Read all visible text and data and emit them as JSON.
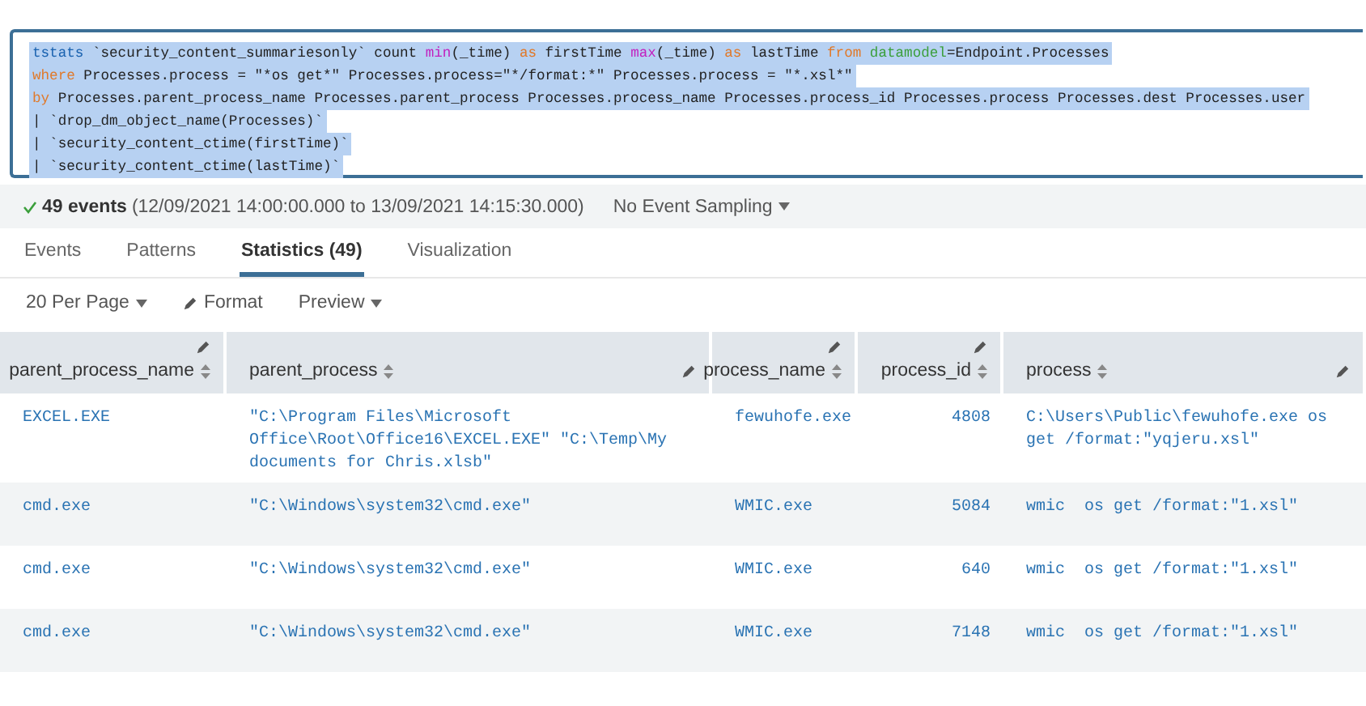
{
  "query": {
    "lines": [
      [
        {
          "kind": "command",
          "text": "tstats"
        },
        {
          "kind": "text",
          "text": " `security_content_summariesonly` count "
        },
        {
          "kind": "function",
          "text": "min"
        },
        {
          "kind": "text",
          "text": "(_time) "
        },
        {
          "kind": "keyword",
          "text": "as"
        },
        {
          "kind": "text",
          "text": " firstTime "
        },
        {
          "kind": "function",
          "text": "max"
        },
        {
          "kind": "text",
          "text": "(_time) "
        },
        {
          "kind": "keyword",
          "text": "as"
        },
        {
          "kind": "text",
          "text": " lastTime "
        },
        {
          "kind": "keyword",
          "text": "from"
        },
        {
          "kind": "argument",
          "text": " datamodel"
        },
        {
          "kind": "text",
          "text": "=Endpoint.Processes"
        }
      ],
      [
        {
          "kind": "keyword",
          "text": "where"
        },
        {
          "kind": "text",
          "text": " Processes.process = \"*os get*\" Processes.process=\"*/format:*\" Processes.process = \"*.xsl*\""
        }
      ],
      [
        {
          "kind": "keyword",
          "text": "by"
        },
        {
          "kind": "text",
          "text": " Processes.parent_process_name Processes.parent_process Processes.process_name Processes.process_id Processes.process Processes.dest Processes.user"
        }
      ],
      [
        {
          "kind": "text",
          "text": "| `drop_dm_object_name(Processes)`"
        }
      ],
      [
        {
          "kind": "text",
          "text": "| `security_content_ctime(firstTime)`"
        }
      ],
      [
        {
          "kind": "text",
          "text": "| `security_content_ctime(lastTime)`"
        }
      ]
    ]
  },
  "summary": {
    "count": "49 events",
    "range": "(12/09/2021 14:00:00.000 to 13/09/2021 14:15:30.000)",
    "sampling": "No Event Sampling"
  },
  "tabs": [
    {
      "label": "Events",
      "selected": false
    },
    {
      "label": "Patterns",
      "selected": false
    },
    {
      "label": "Statistics (49)",
      "selected": true
    },
    {
      "label": "Visualization",
      "selected": false
    }
  ],
  "toolbar": {
    "per_page": "20 Per Page",
    "format": "Format",
    "preview": "Preview"
  },
  "table": {
    "columns": [
      "parent_process_name",
      "parent_process",
      "process_name",
      "process_id",
      "process"
    ],
    "rows": [
      [
        "EXCEL.EXE",
        "\"C:\\Program Files\\Microsoft Office\\Root\\Office16\\EXCEL.EXE\" \"C:\\Temp\\My documents for Chris.xlsb\"",
        "fewuhofe.exe",
        "4808",
        "C:\\Users\\Public\\fewuhofe.exe os get /format:\"yqjeru.xsl\""
      ],
      [
        "cmd.exe",
        "\"C:\\Windows\\system32\\cmd.exe\"",
        "WMIC.exe",
        "5084",
        "wmic  os get /format:\"1.xsl\""
      ],
      [
        "cmd.exe",
        "\"C:\\Windows\\system32\\cmd.exe\"",
        "WMIC.exe",
        "640",
        "wmic  os get /format:\"1.xsl\""
      ],
      [
        "cmd.exe",
        "\"C:\\Windows\\system32\\cmd.exe\"",
        "WMIC.exe",
        "7148",
        "wmic  os get /format:\"1.xsl\""
      ]
    ]
  }
}
